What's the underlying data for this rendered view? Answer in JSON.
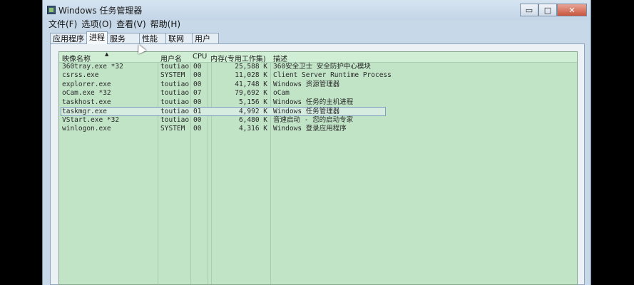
{
  "window": {
    "title": "Windows 任务管理器",
    "minimize": "▭",
    "maximize": "□",
    "close": "✕"
  },
  "menu": [
    "文件(F)",
    "选项(O)",
    "查看(V)",
    "帮助(H)"
  ],
  "tabs": [
    "应用程序",
    "进程",
    "服务",
    "性能",
    "联网",
    "用户"
  ],
  "active_tab": "进程",
  "columns": {
    "image": "映像名称",
    "user": "用户名",
    "cpu": "CPU",
    "mem": "内存(专用工作集)",
    "desc": "描述"
  },
  "processes": [
    {
      "image": "360tray.exe *32",
      "user": "toutiao",
      "cpu": "00",
      "mem": "25,588 K",
      "desc": "360安全卫士 安全防护中心模块"
    },
    {
      "image": "csrss.exe",
      "user": "SYSTEM",
      "cpu": "00",
      "mem": "11,028 K",
      "desc": "Client Server Runtime Process"
    },
    {
      "image": "explorer.exe",
      "user": "toutiao",
      "cpu": "00",
      "mem": "41,748 K",
      "desc": "Windows 资源管理器"
    },
    {
      "image": "oCam.exe *32",
      "user": "toutiao",
      "cpu": "07",
      "mem": "79,692 K",
      "desc": "oCam"
    },
    {
      "image": "taskhost.exe",
      "user": "toutiao",
      "cpu": "00",
      "mem": "5,156 K",
      "desc": "Windows 任务的主机进程"
    },
    {
      "image": "taskmgr.exe",
      "user": "toutiao",
      "cpu": "01",
      "mem": "4,992 K",
      "desc": "Windows 任务管理器"
    },
    {
      "image": "VStart.exe *32",
      "user": "toutiao",
      "cpu": "00",
      "mem": "6,480 K",
      "desc": "音速启动 - 您的启动专家"
    },
    {
      "image": "winlogon.exe",
      "user": "SYSTEM",
      "cpu": "00",
      "mem": "4,316 K",
      "desc": "Windows 登录应用程序"
    }
  ],
  "selected_image": "taskmgr.exe"
}
